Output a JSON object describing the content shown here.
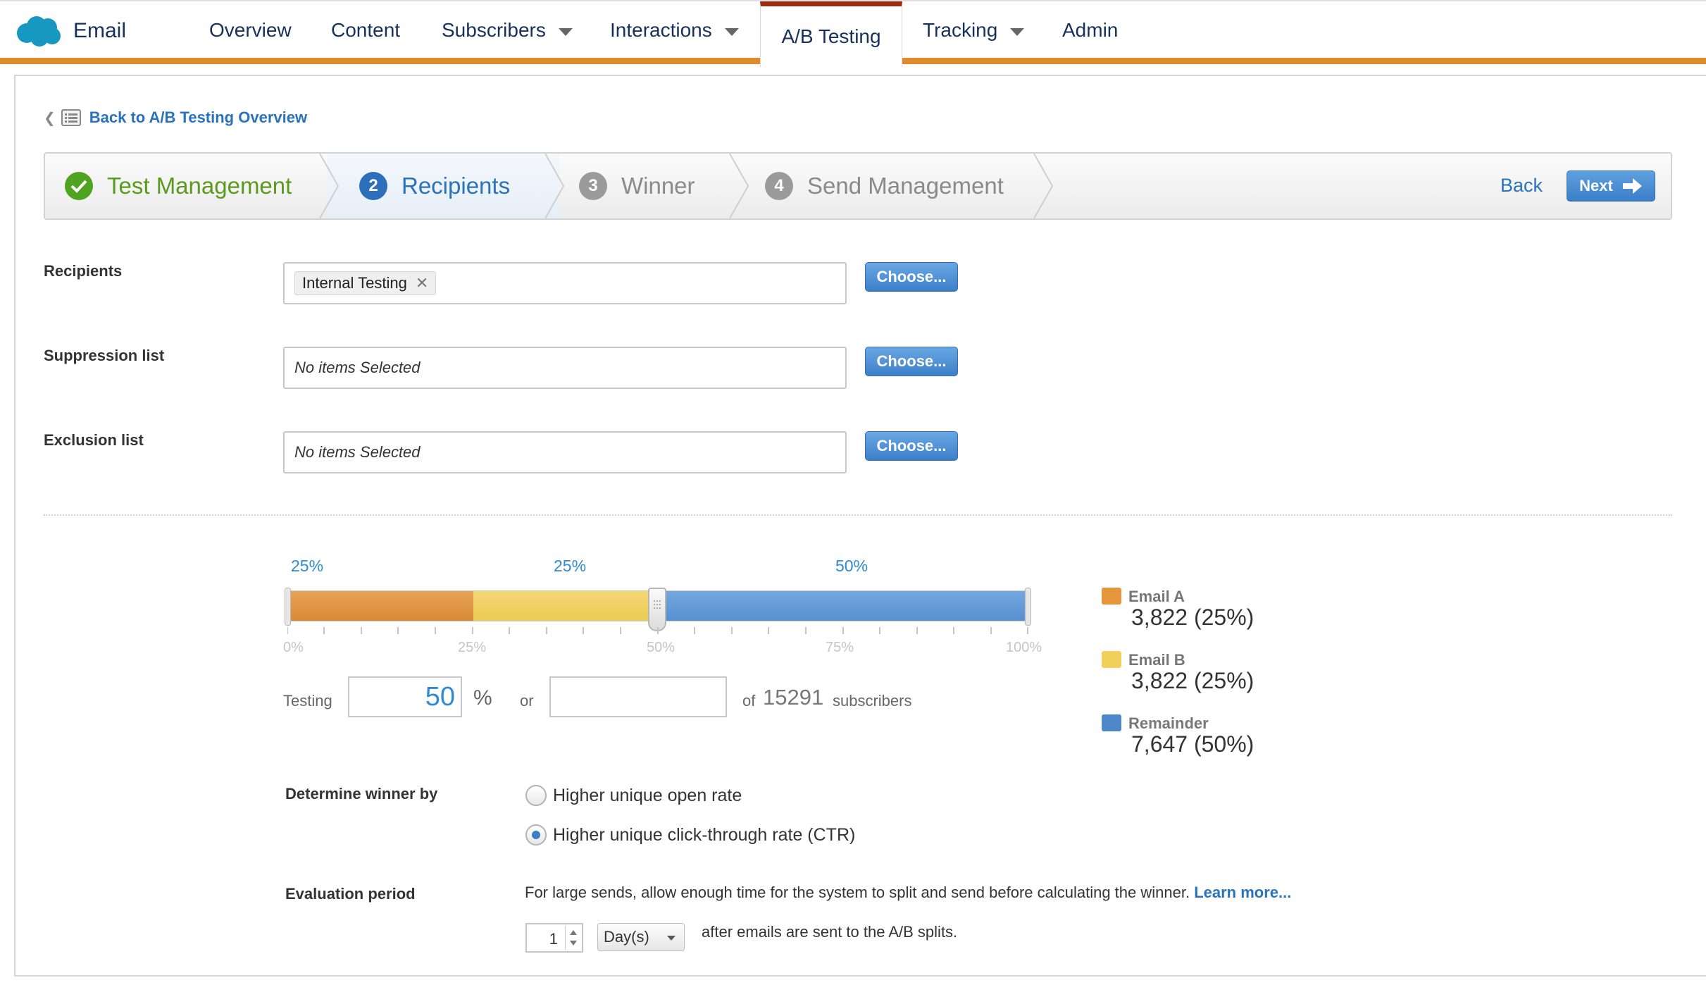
{
  "app": {
    "name": "Email",
    "brand_icon": "salesforce-cloud-icon"
  },
  "nav": {
    "items": [
      {
        "label": "Overview",
        "dropdown": false
      },
      {
        "label": "Content",
        "dropdown": false
      },
      {
        "label": "Subscribers",
        "dropdown": true
      },
      {
        "label": "Interactions",
        "dropdown": true
      },
      {
        "label": "A/B Testing",
        "dropdown": false,
        "active": true
      },
      {
        "label": "Tracking",
        "dropdown": true
      },
      {
        "label": "Admin",
        "dropdown": false
      }
    ]
  },
  "breadcrumb": {
    "back_label": "Back to A/B Testing Overview"
  },
  "wizard": {
    "steps": [
      {
        "number": "1",
        "label": "Test Management",
        "state": "done"
      },
      {
        "number": "2",
        "label": "Recipients",
        "state": "current"
      },
      {
        "number": "3",
        "label": "Winner",
        "state": "pending"
      },
      {
        "number": "4",
        "label": "Send Management",
        "state": "pending"
      }
    ],
    "back_label": "Back",
    "next_label": "Next"
  },
  "recipients": {
    "label": "Recipients",
    "selected_item": "Internal Testing",
    "choose_label": "Choose..."
  },
  "suppression": {
    "label": "Suppression list",
    "placeholder": "No items Selected",
    "choose_label": "Choose..."
  },
  "exclusion": {
    "label": "Exclusion list",
    "placeholder": "No items Selected",
    "choose_label": "Choose..."
  },
  "split": {
    "segment_labels": [
      "25%",
      "25%",
      "50%"
    ],
    "segment_fractions": [
      0.25,
      0.25,
      0.5
    ],
    "scale_labels": [
      "0%",
      "25%",
      "50%",
      "75%",
      "100%"
    ],
    "testing_label": "Testing",
    "testing_percent": "50",
    "percent_sign": "%",
    "or_label": "or",
    "count_value": "",
    "of_label": "of",
    "total_subscribers": "15291",
    "subscribers_label": "subscribers"
  },
  "legend": [
    {
      "name": "Email A",
      "value": "3,822  (25%)",
      "color": "#e6953f"
    },
    {
      "name": "Email B",
      "value": "3,822  (25%)",
      "color": "#f0d05a"
    },
    {
      "name": "Remainder",
      "value": "7,647  (50%)",
      "color": "#4f88c8"
    }
  ],
  "winner": {
    "label": "Determine winner by",
    "options": [
      {
        "label": "Higher unique open rate",
        "selected": false
      },
      {
        "label": "Higher unique click-through rate (CTR)",
        "selected": true
      }
    ]
  },
  "evaluation": {
    "label": "Evaluation period",
    "description": "For large sends, allow enough time for the system to split and send before calculating the winner.",
    "learn_more": "Learn more...",
    "period_value": "1",
    "period_unit": "Day(s)",
    "after_text": "after emails are sent to the A/B splits."
  },
  "colors": {
    "accent_blue": "#2a73bb",
    "nav_orange": "#e08a2c",
    "active_tab_top": "#9b2c0f",
    "success_green": "#4fa31e"
  }
}
